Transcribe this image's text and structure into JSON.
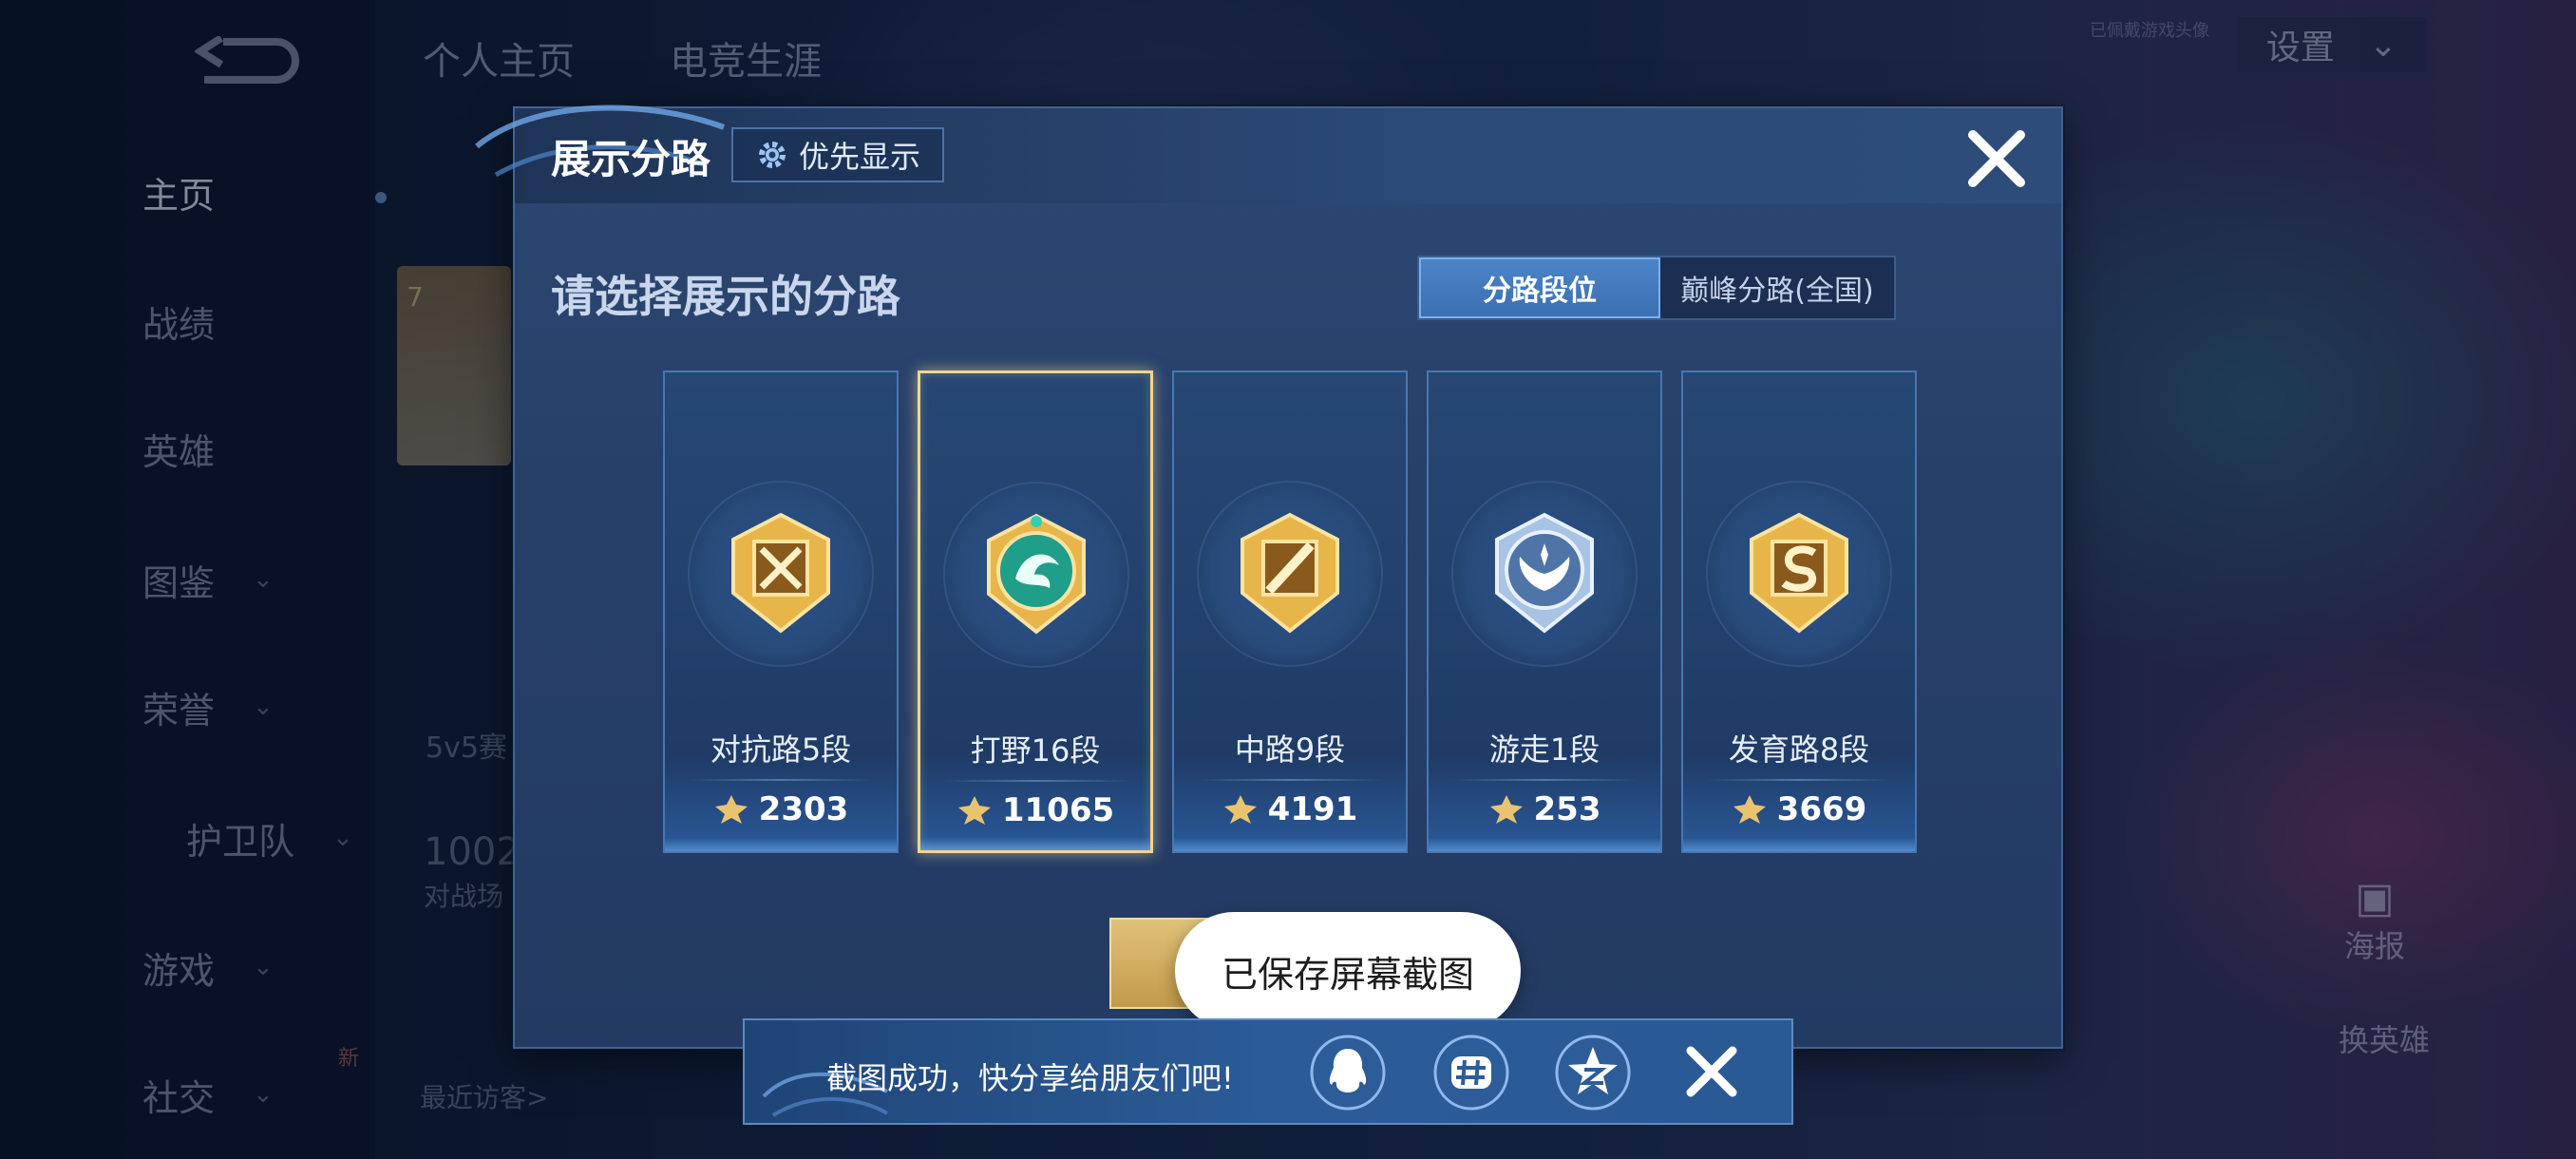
{
  "background": {
    "top_tabs": [
      "个人主页",
      "电竞生涯"
    ],
    "settings_label": "设置",
    "faint_notice": "已佩戴游戏头像",
    "nav_items": [
      {
        "label": "主页",
        "has_chevron": false,
        "active": true
      },
      {
        "label": "战绩",
        "has_chevron": false,
        "active": false
      },
      {
        "label": "英雄",
        "has_chevron": false,
        "active": false
      },
      {
        "label": "图鉴",
        "has_chevron": true,
        "active": false
      },
      {
        "label": "荣誉",
        "has_chevron": true,
        "active": false
      },
      {
        "label": "护卫队",
        "has_chevron": true,
        "active": false
      },
      {
        "label": "游戏",
        "has_chevron": true,
        "active": false
      },
      {
        "label": "社交",
        "has_chevron": true,
        "active": false
      }
    ],
    "level_badge": "7",
    "mode_text": "5v5赛",
    "count_text": "1002",
    "count_sub": "对战场",
    "visitors_label": "最近访客>",
    "new_badge": "新",
    "poster_label": "海报",
    "swap_hero_label": "换英雄"
  },
  "modal": {
    "title": "展示分路",
    "priority_button": "优先显示",
    "prompt": "请选择展示的分路",
    "toggle": {
      "active": "分路段位",
      "other": "巅峰分路(全国)"
    },
    "cards": [
      {
        "lane": "对抗路5段",
        "score": "2303",
        "selected": false,
        "badge": "clash-lane-emblem",
        "badge_color": "#c98f2c"
      },
      {
        "lane": "打野16段",
        "score": "11065",
        "selected": true,
        "badge": "jungle-dragon-emblem",
        "badge_color": "#1f9e8a"
      },
      {
        "lane": "中路9段",
        "score": "4191",
        "selected": false,
        "badge": "mid-lane-emblem",
        "badge_color": "#c98f2c"
      },
      {
        "lane": "游走1段",
        "score": "253",
        "selected": false,
        "badge": "roam-wings-emblem",
        "badge_color": "#8fb0d8"
      },
      {
        "lane": "发育路8段",
        "score": "3669",
        "selected": false,
        "badge": "farm-lane-emblem",
        "badge_color": "#c98f2c"
      }
    ]
  },
  "toast": {
    "text": "已保存屏幕截图"
  },
  "share_bar": {
    "message": "截图成功，快分享给朋友们吧!",
    "icons": [
      "qq-icon",
      "hashtag-icon",
      "qzone-star-icon"
    ]
  }
}
